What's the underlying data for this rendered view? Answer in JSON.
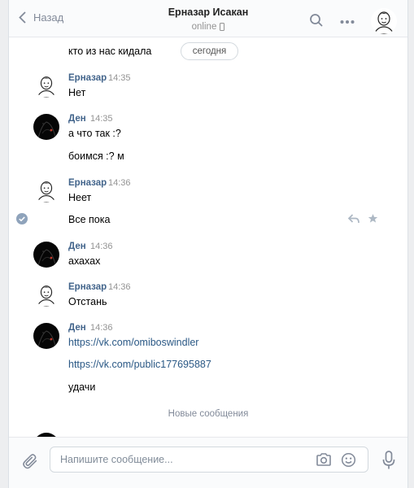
{
  "header": {
    "back_label": "Назад",
    "title": "Ерназар Исакан",
    "status": "online"
  },
  "messages": {
    "first_partial_text": "кто из нас кидала",
    "date_pill": "сегодня",
    "groups": [
      {
        "author": "Ерназар",
        "time": "14:35",
        "lines": [
          "Нет"
        ]
      },
      {
        "author": "Ден",
        "time": "14:35",
        "lines": [
          "а что так :?",
          "боимся :? м"
        ]
      },
      {
        "author": "Ерназар",
        "time": "14:36",
        "lines": [
          "Неет",
          "Все пока"
        ]
      },
      {
        "author": "Ден",
        "time": "14:36",
        "lines": [
          "ахахах"
        ]
      },
      {
        "author": "Ерназар",
        "time": "14:36",
        "lines": [
          "Отстань"
        ]
      },
      {
        "author": "Ден",
        "time": "14:36",
        "lines": [
          "https://vk.com/omiboswindler",
          "https://vk.com/public177695887",
          "удачи"
        ]
      }
    ],
    "new_messages_divider": "Новые сообщения"
  },
  "composer": {
    "placeholder": "Напишите сообщение..."
  },
  "colors": {
    "author": "#42648b",
    "link": "#2a5885",
    "muted": "#939393",
    "icon": "#828a99"
  }
}
